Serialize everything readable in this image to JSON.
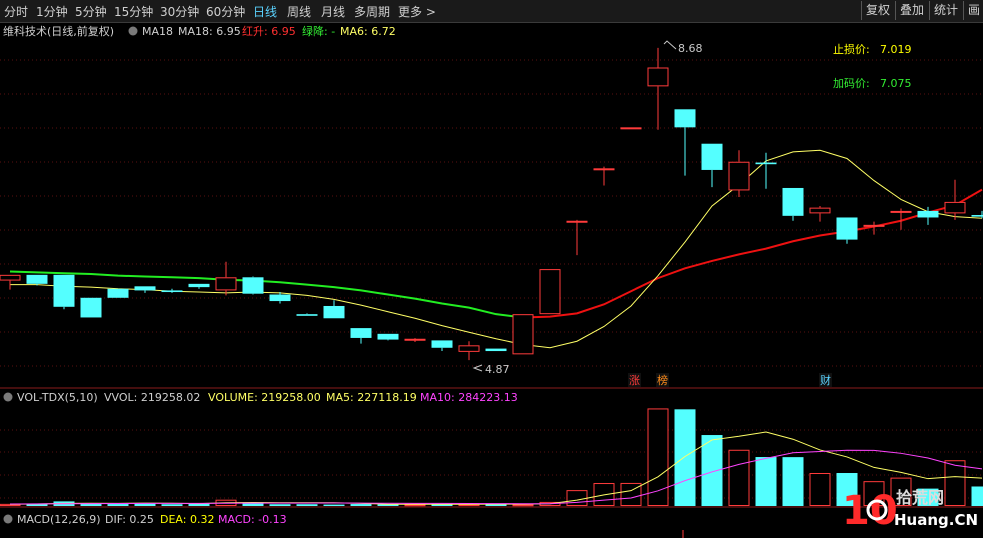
{
  "toolbar": {
    "periods": [
      "分时",
      "1分钟",
      "5分钟",
      "15分钟",
      "30分钟",
      "60分钟",
      "日线",
      "周线",
      "月线",
      "多周期",
      "更多 >"
    ],
    "active_period": "日线",
    "right_buttons": [
      "复权",
      "叠加",
      "统计",
      "画"
    ]
  },
  "main_panel": {
    "title": "维科技术(日线,前复权)",
    "indicator_prefix": "MA18",
    "ma18_label": "MA18: 6.95",
    "red_up_label": "红升: 6.95",
    "green_down_label": "绿降: -",
    "ma6_label": "MA6: 6.72",
    "high_marker": "8.68",
    "low_marker": "4.87",
    "stop_loss_label": "止损价:",
    "stop_loss_value": "7.019",
    "add_pos_label": "加码价:",
    "add_pos_value": "7.075",
    "event_marks": [
      "涨",
      "榜",
      "财"
    ]
  },
  "vol_panel": {
    "title": "VOL-TDX(5,10)",
    "vvol": "VVOL: 219258.02",
    "volume": "VOLUME: 219258.00",
    "ma5": "MA5: 227118.19",
    "ma10": "MA10: 284223.13"
  },
  "macd_panel": {
    "title": "MACD(12,26,9)",
    "dif": "DIF: 0.25",
    "dea": "DEA: 0.32",
    "macd": "MACD: -0.13"
  },
  "watermark": {
    "brand_num": "10",
    "text_cn": "拾荒网",
    "text_en": "Huang.CN"
  },
  "colors": {
    "up": "#ff3b3b",
    "down": "#54ffff",
    "ma6": "#ffff66",
    "ma18_green": "#22ee22",
    "ma18_red": "#ee1111",
    "vol_ma10": "#ff44ff",
    "macd_dea": "#ffff00",
    "macd_dea_val": "#ffff00",
    "macd_val": "#ff44ff"
  },
  "chart_data": {
    "type": "candlestick",
    "candles": [
      {
        "o": 5.84,
        "h": 5.91,
        "l": 5.73,
        "c": 5.91
      },
      {
        "o": 5.91,
        "h": 5.91,
        "l": 5.78,
        "c": 5.8
      },
      {
        "o": 5.91,
        "h": 5.91,
        "l": 5.49,
        "c": 5.52
      },
      {
        "o": 5.63,
        "h": 5.63,
        "l": 5.39,
        "c": 5.39
      },
      {
        "o": 5.74,
        "h": 5.74,
        "l": 5.63,
        "c": 5.63
      },
      {
        "o": 5.77,
        "h": 5.77,
        "l": 5.69,
        "c": 5.72
      },
      {
        "o": 5.72,
        "h": 5.74,
        "l": 5.69,
        "c": 5.7
      },
      {
        "o": 5.8,
        "h": 5.8,
        "l": 5.74,
        "c": 5.76
      },
      {
        "o": 5.72,
        "h": 6.07,
        "l": 5.66,
        "c": 5.88
      },
      {
        "o": 5.88,
        "h": 5.89,
        "l": 5.67,
        "c": 5.68
      },
      {
        "o": 5.67,
        "h": 5.7,
        "l": 5.56,
        "c": 5.59
      },
      {
        "o": 5.43,
        "h": 5.44,
        "l": 5.41,
        "c": 5.41
      },
      {
        "o": 5.53,
        "h": 5.6,
        "l": 5.38,
        "c": 5.38
      },
      {
        "o": 5.26,
        "h": 5.26,
        "l": 5.07,
        "c": 5.14
      },
      {
        "o": 5.19,
        "h": 5.19,
        "l": 5.11,
        "c": 5.12
      },
      {
        "o": 5.12,
        "h": 5.14,
        "l": 5.09,
        "c": 5.13
      },
      {
        "o": 5.11,
        "h": 5.11,
        "l": 4.98,
        "c": 5.02
      },
      {
        "o": 4.97,
        "h": 5.1,
        "l": 4.87,
        "c": 5.05
      },
      {
        "o": 5.01,
        "h": 5.01,
        "l": 4.98,
        "c": 4.98
      },
      {
        "o": 4.94,
        "h": 5.43,
        "l": 4.94,
        "c": 5.43
      },
      {
        "o": 5.43,
        "h": 5.98,
        "l": 5.43,
        "c": 5.98
      },
      {
        "o": 6.57,
        "h": 6.58,
        "l": 6.15,
        "c": 6.57
      },
      {
        "o": 7.21,
        "h": 7.23,
        "l": 7.0,
        "c": 7.21
      },
      {
        "o": 7.71,
        "h": 7.71,
        "l": 7.71,
        "c": 7.71
      },
      {
        "o": 8.21,
        "h": 8.68,
        "l": 7.68,
        "c": 8.44
      },
      {
        "o": 7.93,
        "h": 7.93,
        "l": 7.12,
        "c": 7.71
      },
      {
        "o": 7.51,
        "h": 7.51,
        "l": 6.98,
        "c": 7.19
      },
      {
        "o": 6.94,
        "h": 7.43,
        "l": 6.86,
        "c": 7.29
      },
      {
        "o": 7.28,
        "h": 7.4,
        "l": 6.96,
        "c": 7.26
      },
      {
        "o": 6.97,
        "h": 6.97,
        "l": 6.57,
        "c": 6.63
      },
      {
        "o": 6.66,
        "h": 6.75,
        "l": 6.56,
        "c": 6.73
      },
      {
        "o": 6.61,
        "h": 6.61,
        "l": 6.29,
        "c": 6.34
      },
      {
        "o": 6.52,
        "h": 6.56,
        "l": 6.4,
        "c": 6.52
      },
      {
        "o": 6.69,
        "h": 6.72,
        "l": 6.46,
        "c": 6.69
      },
      {
        "o": 6.69,
        "h": 6.74,
        "l": 6.52,
        "c": 6.61
      },
      {
        "o": 6.66,
        "h": 7.07,
        "l": 6.58,
        "c": 6.8
      },
      {
        "o": 6.64,
        "h": 6.69,
        "l": 6.6,
        "c": 6.62
      }
    ],
    "ma6": [
      5.79,
      5.79,
      5.77,
      5.76,
      5.74,
      5.73,
      5.71,
      5.7,
      5.69,
      5.7,
      5.69,
      5.66,
      5.61,
      5.54,
      5.46,
      5.38,
      5.29,
      5.21,
      5.13,
      5.06,
      5.02,
      5.1,
      5.28,
      5.53,
      5.9,
      6.31,
      6.75,
      7.01,
      7.3,
      7.41,
      7.43,
      7.33,
      7.06,
      6.83,
      6.68,
      6.62,
      6.6
    ],
    "ma18": [
      5.95,
      5.94,
      5.93,
      5.92,
      5.9,
      5.89,
      5.88,
      5.87,
      5.85,
      5.84,
      5.82,
      5.79,
      5.76,
      5.72,
      5.67,
      5.62,
      5.56,
      5.51,
      5.43,
      5.39,
      5.4,
      5.44,
      5.55,
      5.71,
      5.87,
      5.99,
      6.08,
      6.16,
      6.23,
      6.32,
      6.39,
      6.44,
      6.5,
      6.57,
      6.67,
      6.76,
      6.95
    ],
    "ma18_split_index": 19,
    "price_axis": [
      4.7,
      8.8
    ],
    "volume": [
      0.24,
      0.22,
      0.52,
      0.28,
      0.22,
      0.34,
      0.2,
      0.33,
      0.71,
      0.4,
      0.2,
      0.2,
      0.16,
      0.22,
      0.2,
      0.2,
      0.2,
      0.24,
      0.2,
      0.2,
      0.46,
      1.79,
      2.59,
      2.6,
      11.0,
      10.9,
      8.0,
      6.34,
      5.52,
      5.51,
      3.72,
      3.72,
      2.8,
      3.2,
      1.96,
      5.16,
      2.2
    ],
    "vol_ma5": [
      0.2,
      0.22,
      0.3,
      0.31,
      0.3,
      0.32,
      0.31,
      0.27,
      0.36,
      0.4,
      0.37,
      0.37,
      0.37,
      0.3,
      0.2,
      0.2,
      0.2,
      0.2,
      0.21,
      0.21,
      0.26,
      0.66,
      1.26,
      1.73,
      3.29,
      5.58,
      7.45,
      7.86,
      8.34,
      7.53,
      6.32,
      5.53,
      4.35,
      3.79,
      3.08,
      3.31,
      3.14
    ],
    "vol_ma10": [
      0.22,
      0.24,
      0.26,
      0.27,
      0.28,
      0.29,
      0.3,
      0.29,
      0.31,
      0.33,
      0.33,
      0.33,
      0.34,
      0.32,
      0.31,
      0.3,
      0.29,
      0.28,
      0.27,
      0.26,
      0.26,
      0.41,
      0.66,
      0.9,
      1.71,
      2.86,
      3.85,
      4.69,
      5.37,
      6.0,
      6.14,
      6.28,
      6.27,
      5.94,
      5.41,
      4.6,
      4.19
    ],
    "vol_axis_max": 11.5
  }
}
